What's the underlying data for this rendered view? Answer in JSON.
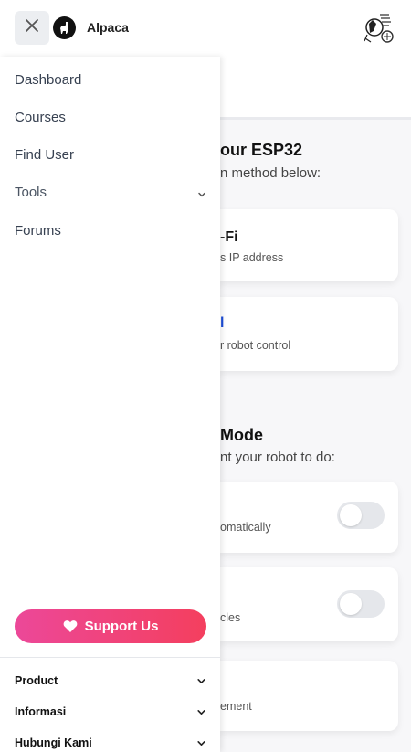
{
  "header": {
    "brand_name": "Alpaca",
    "close_icon": "close-icon",
    "logo_icon": "alpaca-logo",
    "avatar": "user-avatar"
  },
  "sidebar": {
    "items": [
      {
        "label": "Dashboard"
      },
      {
        "label": "Courses"
      },
      {
        "label": "Find User"
      },
      {
        "label": "Tools",
        "has_submenu": true
      },
      {
        "label": "Forums"
      }
    ],
    "support_label": "Support Us",
    "footer": [
      {
        "label": "Product"
      },
      {
        "label": "Informasi"
      },
      {
        "label": "Hubungi Kami"
      }
    ]
  },
  "background": {
    "connect": {
      "title": "our ESP32",
      "subtitle": "n method below:",
      "cards": [
        {
          "title": "-Fi",
          "desc": "s IP address"
        },
        {
          "title": "l",
          "desc": "r robot control"
        }
      ]
    },
    "mode": {
      "title": "Mode",
      "subtitle": "nt your robot to do:",
      "cards": [
        {
          "desc": "omatically",
          "toggle_on": false
        },
        {
          "desc": "cles",
          "toggle_on": false
        },
        {
          "desc": "ement"
        }
      ]
    }
  },
  "colors": {
    "support_gradient_start": "#ec4899",
    "support_gradient_end": "#f43f5e",
    "link_blue": "#1d4ed8"
  }
}
